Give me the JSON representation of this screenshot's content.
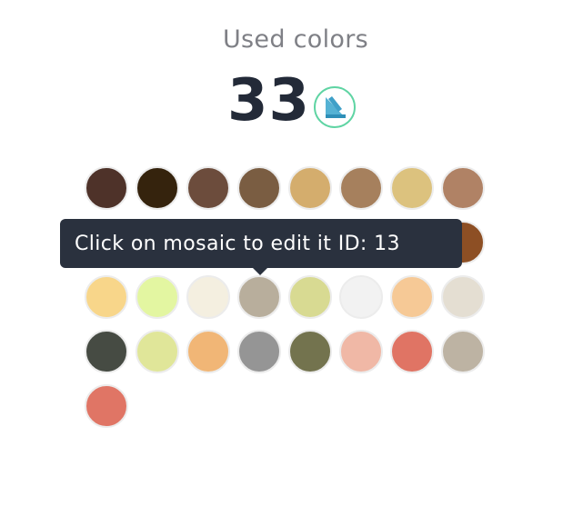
{
  "title": "Used colors",
  "count": "33",
  "badge_icon": "brand-logo-icon",
  "badge_border_color": "#5fd4a3",
  "tooltip": {
    "text": "Click on mosaic to edit it ID: 13"
  },
  "colors": [
    "#4e3229",
    "#35230d",
    "#6c4c3c",
    "#7a5d42",
    "#d4ad6d",
    "#a6805d",
    "#dcc27e",
    "#b08265",
    "#4e3229",
    "#35230d",
    "#6c4c3c",
    "#7a5d42",
    "#d4ad6d",
    "#a6805d",
    "#dcc27e",
    "#8d4f24",
    "#f8d68a",
    "#e3f6a1",
    "#f4efe0",
    "#b8ae9c",
    "#d8da92",
    "#f2f2f2",
    "#f6c996",
    "#e4ded2",
    "#464b43",
    "#e0e699",
    "#f1b676",
    "#959595",
    "#73734e",
    "#f0b8a6",
    "#e07464",
    "#bdb3a3",
    "#e07565"
  ]
}
